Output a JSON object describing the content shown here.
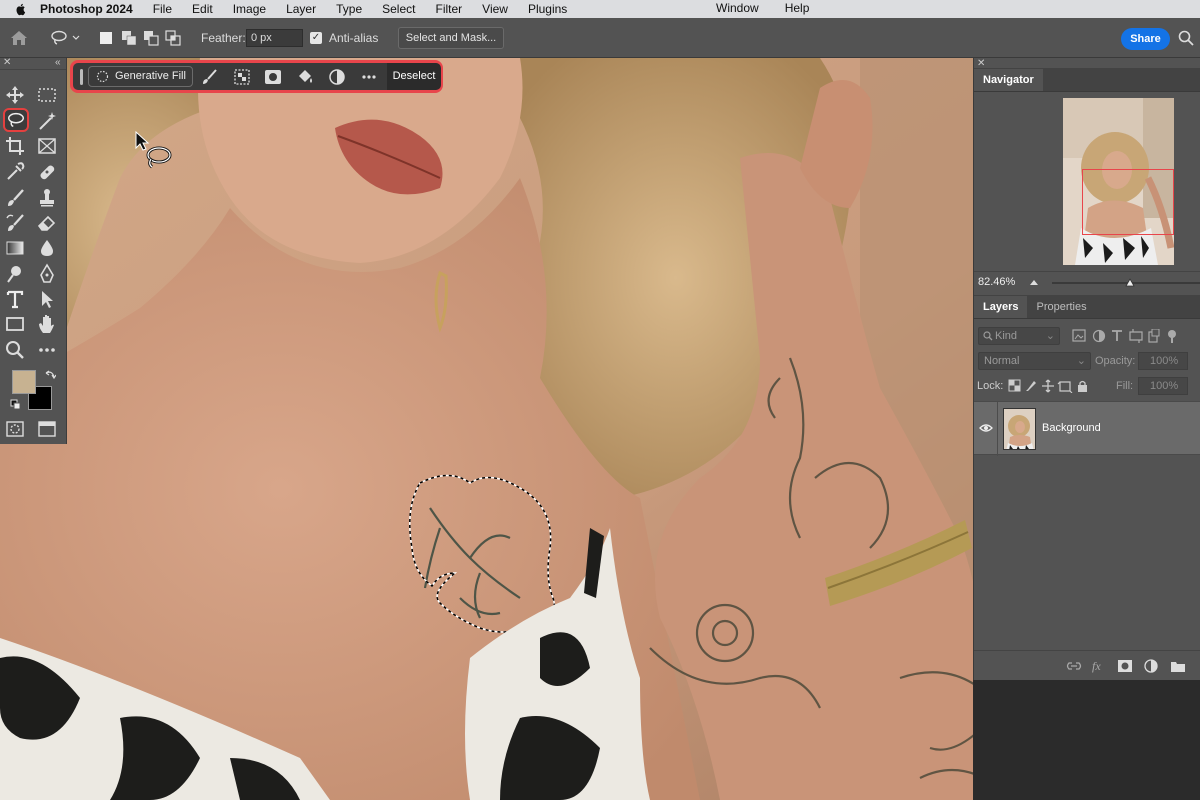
{
  "menubar": {
    "app_name": "Photoshop 2024",
    "items": [
      "File",
      "Edit",
      "Image",
      "Layer",
      "Type",
      "Select",
      "Filter",
      "View",
      "Plugins"
    ],
    "right_items": [
      "Window",
      "Help"
    ]
  },
  "options_bar": {
    "feather_label": "Feather:",
    "feather_value": "0 px",
    "antialias_label": "Anti-alias",
    "antialias_checked": true,
    "select_mask_label": "Select and Mask...",
    "share_label": "Share"
  },
  "taskbar": {
    "generative_fill_label": "Generative Fill",
    "deselect_label": "Deselect"
  },
  "toolbar": {
    "foreground_color": "#c7b291",
    "background_color": "#000000",
    "active_tool": "lasso-tool"
  },
  "navigator": {
    "tab_label": "Navigator",
    "zoom": "82.46%"
  },
  "layers_panel": {
    "tabs": [
      "Layers",
      "Properties"
    ],
    "kind_label": "Kind",
    "blend_mode": "Normal",
    "opacity_label": "Opacity:",
    "opacity_value": "100%",
    "lock_label": "Lock:",
    "fill_label": "Fill:",
    "fill_value": "100%",
    "layers": [
      {
        "name": "Background",
        "visible": true
      }
    ]
  },
  "colors": {
    "accent_red": "#e8454b",
    "share_blue": "#1473e6",
    "panel_bg": "#535353"
  }
}
